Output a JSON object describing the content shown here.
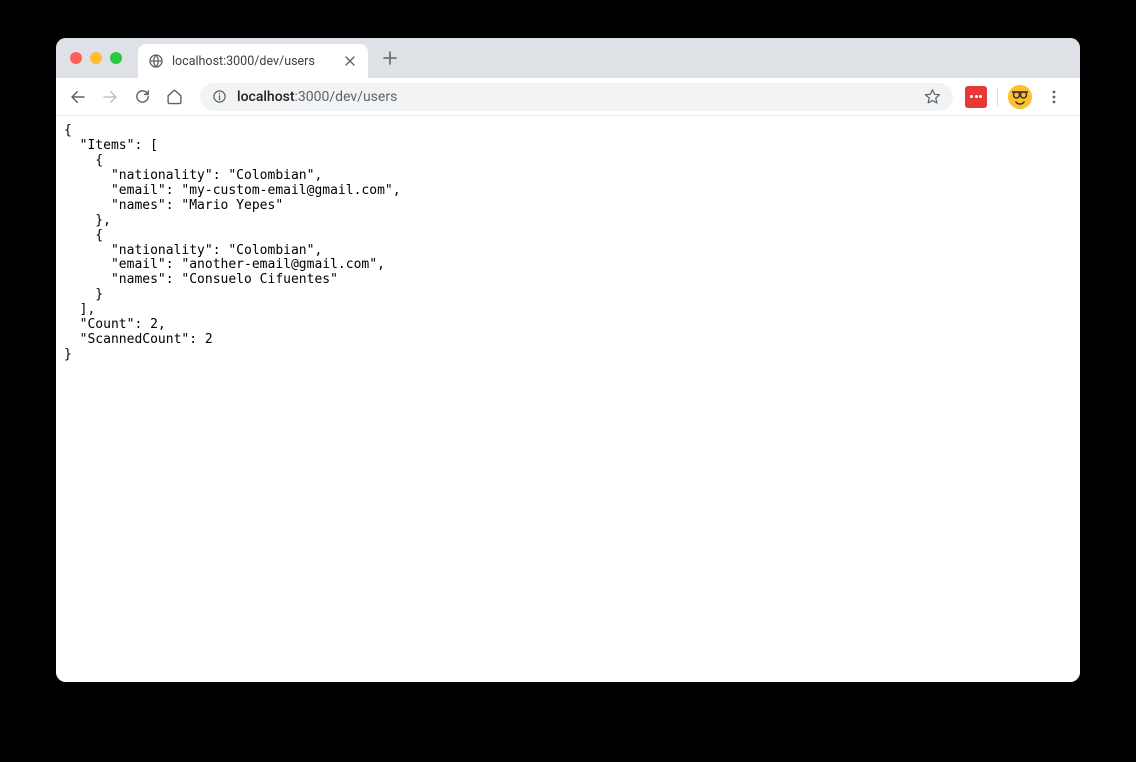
{
  "tab": {
    "title": "localhost:3000/dev/users"
  },
  "address": {
    "host": "localhost",
    "rest": ":3000/dev/users"
  },
  "response": {
    "Items": [
      {
        "nationality": "Colombian",
        "email": "my-custom-email@gmail.com",
        "names": "Mario Yepes"
      },
      {
        "nationality": "Colombian",
        "email": "another-email@gmail.com",
        "names": "Consuelo Cifuentes"
      }
    ],
    "Count": 2,
    "ScannedCount": 2
  }
}
